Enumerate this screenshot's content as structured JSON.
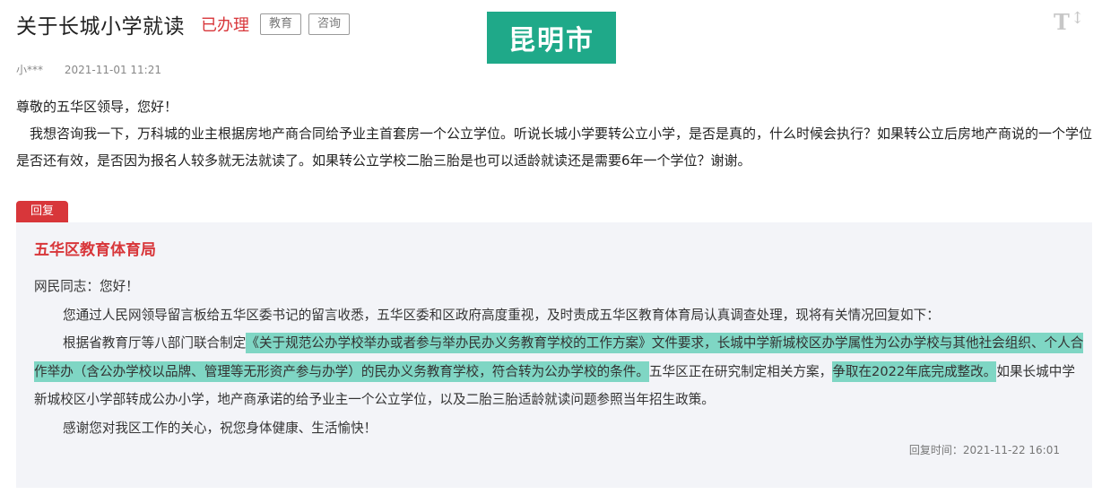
{
  "header": {
    "title": "关于长城小学就读",
    "status": "已办理",
    "tags": [
      "教育",
      "咨询"
    ],
    "city_badge": "昆明市",
    "font_size_icon": "text-size-icon"
  },
  "meta": {
    "author": "小***",
    "datetime": "2021-11-01 11:21"
  },
  "question": {
    "greeting": "尊敬的五华区领导，您好！",
    "body": "我想咨询我一下，万科城的业主根据房地产商合同给予业主首套房一个公立学位。听说长城小学要转公立小学，是否是真的，什么时候会执行？如果转公立后房地产商说的一个学位是否还有效，是否因为报名人较多就无法就读了。如果转公立学校二胎三胎是也可以适龄就读还是需要6年一个学位？谢谢。"
  },
  "reply": {
    "tab_label": "回复",
    "department": "五华区教育体育局",
    "greeting": "网民同志：您好！",
    "p1": "您通过人民网领导留言板给五华区委书记的留言收悉，五华区委和区政府高度重视，及时责成五华区教育体育局认真调查处理，现将有关情况回复如下：",
    "p2_prefix": "根据省教育厅等八部门联合制定",
    "p2_highlight1": "《关于规范公办学校举办或者参与举办民办义务教育学校的工作方案》文件要求，长城中学新城校区办学属性为公办学校与其他社会组织、个人合作举办（含公办学校以品牌、管理等无形资产参与办学）的民办义务教育学校，符合转为公办学校的条件。",
    "p2_middle": "五华区正在研究制定相关方案，",
    "p2_highlight2": "争取在2022年底完成整改。",
    "p2_suffix": "如果长城中学新城校区小学部转成公办小学，地产商承诺的给予业主一个公立学位，以及二胎三胎适龄就读问题参照当年招生政策。",
    "p3": "感谢您对我区工作的关心，祝您身体健康、生活愉快！",
    "time": "回复时间：2021-11-22 16:01"
  },
  "colors": {
    "accent_red": "#d8363a",
    "badge_green": "#1fa989",
    "highlight": "#7fd6c4",
    "reply_bg": "#f3f4f8"
  }
}
